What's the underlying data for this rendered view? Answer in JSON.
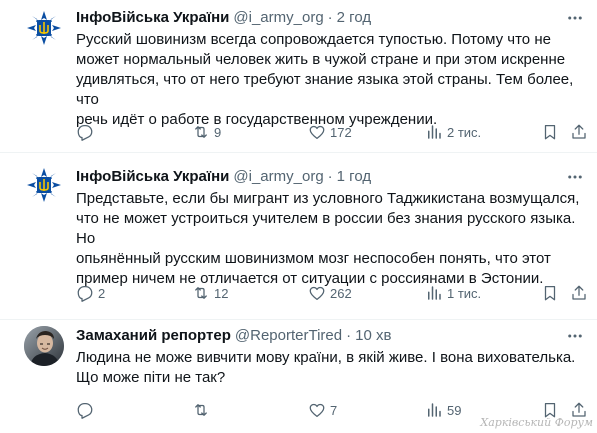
{
  "tweets": [
    {
      "name": "ІнфоВійська України",
      "handle": "@i_army_org",
      "dot": "·",
      "time": "2 год",
      "avatar": "i-army-emblem",
      "text": "Русский шовинизм всегда сопровождается тупостью. Потому что не\nможет нормальный человек жить в чужой стране и при этом искренне\nудивляться, что от него требуют знание языка этой страны. Тем более, что\nречь идёт о работе в государственном учреждении.",
      "replies": "",
      "retweets": "9",
      "likes": "172",
      "views": "2 тис."
    },
    {
      "name": "ІнфоВійська України",
      "handle": "@i_army_org",
      "dot": "·",
      "time": "1 год",
      "avatar": "i-army-emblem",
      "text": "Представьте, если бы мигрант из условного Таджикистана возмущался,\nчто не может устроиться учителем в россии без знания русского языка. Но\nопьянённый русским шовинизмом мозг неспособен понять, что этот\nпример ничем не отличается от ситуации с россиянами в Эстонии.",
      "replies": "2",
      "retweets": "12",
      "likes": "262",
      "views": "1 тис."
    },
    {
      "name": "Замаханий репортер",
      "handle": "@ReporterTired",
      "dot": "·",
      "time": "10 хв",
      "avatar": "person-photo",
      "text": "Людина не може вивчити мову країни, в якій живе. І вона вихователька.\nЩо може піти не так?",
      "replies": "",
      "retweets": "",
      "likes": "7",
      "views": "59"
    }
  ],
  "icons": {
    "more": "more-dots-icon",
    "reply": "reply-icon",
    "retweet": "retweet-icon",
    "like": "heart-icon",
    "views": "views-icon",
    "bookmark": "bookmark-icon",
    "share": "share-icon"
  },
  "colors": {
    "text": "#0f1419",
    "secondary": "#536471",
    "divider": "#eff3f4",
    "emblem_blue": "#0b4ea2",
    "emblem_gold": "#f4c400"
  },
  "watermark": "Харківський Форум"
}
